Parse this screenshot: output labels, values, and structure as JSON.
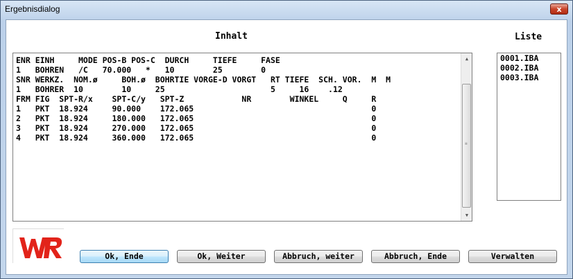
{
  "window": {
    "title": "Ergebnisdialog",
    "close_label": "x"
  },
  "content": {
    "label": "Inhalt",
    "lines": [
      "ENR EINH     MODE POS-B POS-C  DURCH     TIEFE     FASE",
      "1   BOHREN   /C   70.000   *   10        25        0",
      "SNR WERKZ.  NOM.ø     BOH.ø  BOHRTIE VORGE-D VORGT   RT TIEFE  SCH. VOR.  M  M",
      "1   BOHRER  10        10     25                      5     16    .12",
      "FRM FIG  SPT-R/x    SPT-C/y   SPT-Z            NR        WINKEL     Q     R",
      "1   PKT  18.924     90.000    172.065                                     0",
      "2   PKT  18.924     180.000   172.065                                     0",
      "3   PKT  18.924     270.000   172.065                                     0",
      "4   PKT  18.924     360.000   172.065                                     0"
    ]
  },
  "list": {
    "label": "Liste",
    "items": [
      "0001.IBA",
      "0002.IBA",
      "0003.IBA"
    ]
  },
  "logo": {
    "text": "WR",
    "color": "#e2231a"
  },
  "buttons": {
    "ok_ende": "Ok, Ende",
    "ok_weiter": "Ok, Weiter",
    "abbruch_weiter": "Abbruch, weiter",
    "abbruch_ende": "Abbruch, Ende",
    "verwalten": "Verwalten"
  },
  "colors": {
    "accent": "#3c7fb1",
    "close": "#c9442a"
  }
}
